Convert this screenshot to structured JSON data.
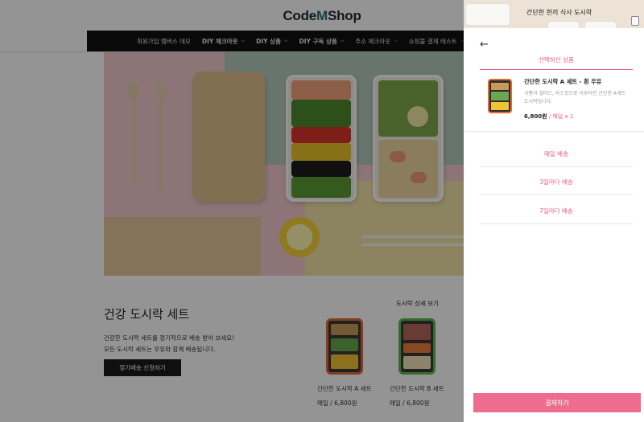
{
  "site": {
    "logo_prefix": "Code",
    "logo_m": "M",
    "logo_suffix": "Shop"
  },
  "nav": {
    "items": [
      {
        "label": "회원가입 멤버스 데모",
        "bold": false,
        "dropdown": false
      },
      {
        "label": "DIY 체크아웃",
        "bold": true,
        "dropdown": true
      },
      {
        "label": "DIY 상품",
        "bold": true,
        "dropdown": true
      },
      {
        "label": "DIY 구독 상품",
        "bold": true,
        "dropdown": true
      },
      {
        "label": "주소 체크아웃",
        "bold": false,
        "dropdown": true
      },
      {
        "label": "쇼핑몰 결제 테스트",
        "bold": false,
        "dropdown": true
      }
    ]
  },
  "section": {
    "title": "건강 도시락 세트",
    "desc_line1": "건강한 도시락 세트를 정기적으로 배송 받아 보세요!",
    "desc_line2": "모든 도시락 세트는 우유와 함께 배송됩니다.",
    "cta_label": "정기배송 신청하기",
    "detail_link": "도시락 상세 보기"
  },
  "products": [
    {
      "name": "간단한 도시락 A 세트",
      "price": "매일 / 6,800원",
      "border_color": "#e36a35"
    },
    {
      "name": "간단한 도시락 B 세트",
      "price": "매일 / 6,800원",
      "border_color": "#5cba4a"
    }
  ],
  "drawer": {
    "header_title": "간단한 한끼 식사 도시락",
    "back_icon": "arrow-left-icon",
    "selected_tab": "선택하신 상품",
    "item": {
      "name": "간단한 도시락 A 세트 - 흰 우유",
      "desc": "식빵과 샐러드, 비스킷으로 이루어진 간단한 A세트 도시락입니다.",
      "price": "6,800원",
      "frequency": " / 매일 x 1"
    },
    "delivery_options": [
      "매일 배송",
      "3일마다 배송",
      "7일마다 배송"
    ],
    "checkout_label": "결제하기"
  },
  "colors": {
    "accent": "#ec5b85",
    "checkout": "#ee6d8e",
    "nav_bg": "#111111"
  }
}
